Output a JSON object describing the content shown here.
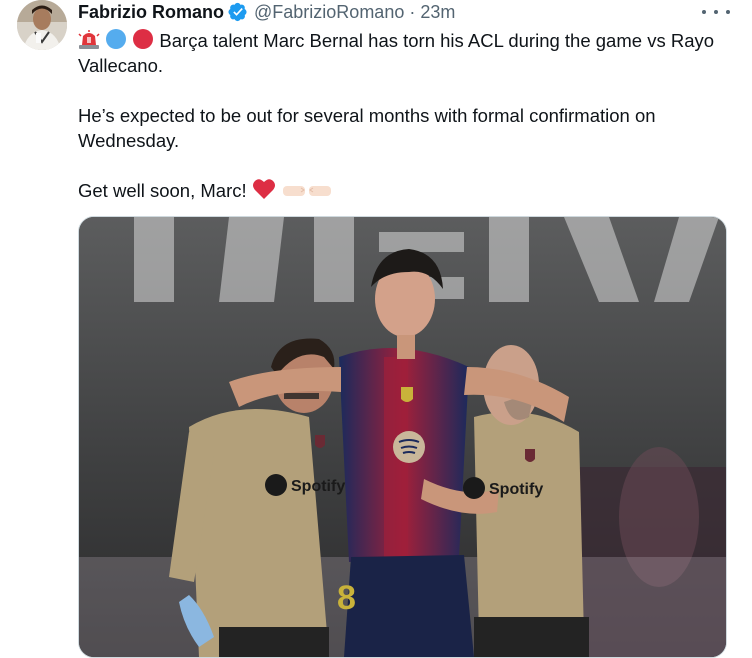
{
  "tweet": {
    "author_name": "Fabrizio Romano",
    "author_handle": "@FabrizioRomano",
    "separator": "·",
    "time": "23m",
    "text_line1": "Barça talent Marc Bernal has torn his ACL during the game vs Rayo Vallecano.",
    "text_line2": "He’s expected to be out for several months with formal confirmation on Wednesday.",
    "text_line3": "Get well soon, Marc!"
  },
  "icons": {
    "verified": "verified-badge-icon",
    "more": "more-options-icon",
    "siren": "police-light-emoji",
    "blue_circle": "blue-circle-emoji",
    "red_circle": "red-circle-emoji",
    "heart": "red-heart-emoji",
    "fist": "fist-bump-emoji"
  },
  "colors": {
    "verified": "#1d9bf0",
    "secondary_text": "#536471",
    "primary_text": "#0f1419",
    "barca_blue": "#1b2a5c",
    "barca_red": "#a0203a"
  },
  "media": {
    "sponsor": "Spotify"
  }
}
